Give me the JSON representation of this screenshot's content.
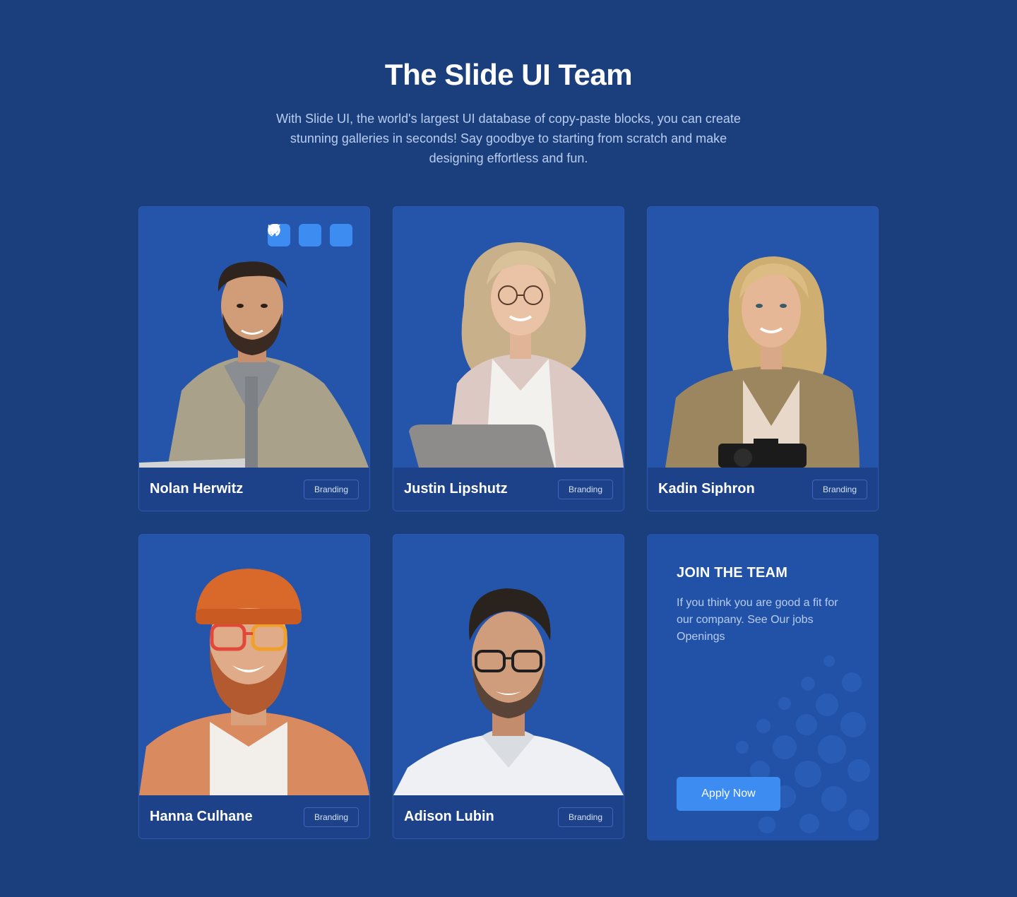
{
  "header": {
    "title": "The Slide UI Team",
    "subtitle": "With Slide UI, the world's largest UI database of copy-paste blocks, you can create stunning galleries in seconds! Say goodbye to starting from scratch and make designing effortless and fun."
  },
  "team": [
    {
      "name": "Nolan Herwitz",
      "tag": "Branding"
    },
    {
      "name": "Justin Lipshutz",
      "tag": "Branding"
    },
    {
      "name": "Kadin Siphron",
      "tag": "Branding"
    },
    {
      "name": "Hanna Culhane",
      "tag": "Branding"
    },
    {
      "name": "Adison Lubin",
      "tag": "Branding"
    }
  ],
  "socials": [
    {
      "icon": "facebook-icon"
    },
    {
      "icon": "twitter-icon"
    },
    {
      "icon": "github-icon"
    }
  ],
  "join": {
    "title": "JOIN THE TEAM",
    "text": "If you think you are good a fit for our company. See Our jobs Openings",
    "button": "Apply Now"
  },
  "colors": {
    "background": "#1b3f7d",
    "card": "#2455aa",
    "accent": "#3c8cf2"
  }
}
